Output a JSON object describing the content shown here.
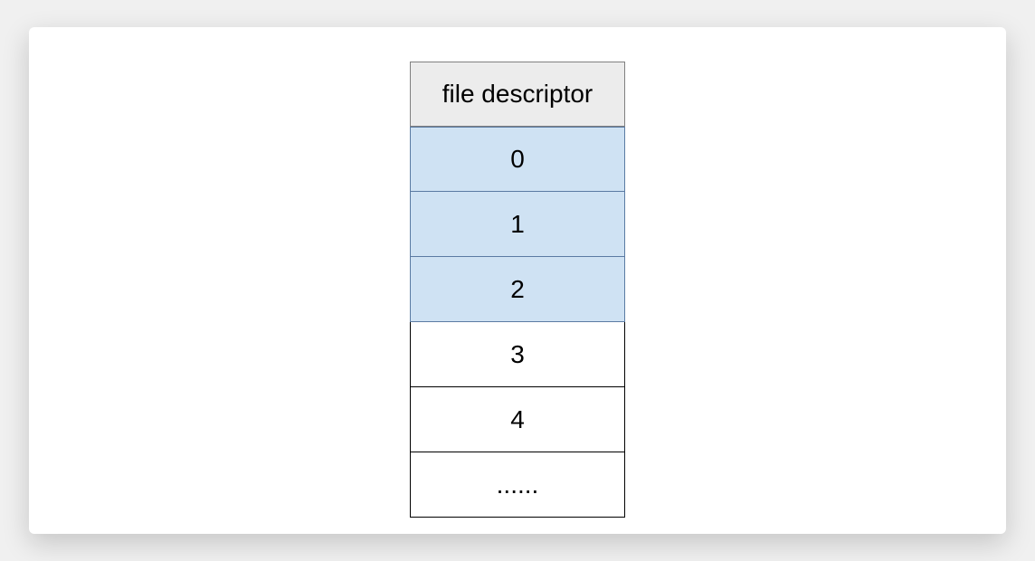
{
  "table": {
    "header": "file descriptor",
    "rows": [
      {
        "value": "0",
        "highlighted": true
      },
      {
        "value": "1",
        "highlighted": true
      },
      {
        "value": "2",
        "highlighted": true
      },
      {
        "value": "3",
        "highlighted": false
      },
      {
        "value": "4",
        "highlighted": false
      },
      {
        "value": "......",
        "highlighted": false
      }
    ]
  },
  "colors": {
    "highlight_bg": "#cfe2f3",
    "highlight_border": "#5b7ba3",
    "header_bg": "#ececec",
    "header_border": "#808080",
    "plain_border": "#000000"
  }
}
